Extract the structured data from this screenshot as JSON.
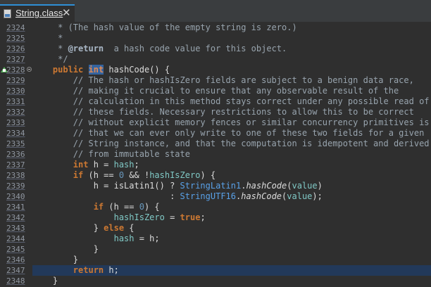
{
  "tab": {
    "title": "String.class",
    "close_glyph": "✕",
    "icon": "class-file-icon"
  },
  "colors": {
    "background": "#2f2f2f",
    "tab_accent": "#2e8fd6",
    "current_line": "#22395a",
    "comment": "#98a4ae",
    "keyword": "#cc7832",
    "class_reference": "#59a1e8",
    "number": "#6897bb"
  },
  "editor": {
    "current_line_number": "2347",
    "override_marker_line": "2328",
    "lines": [
      {
        "number": "2324",
        "tokens": [
          {
            "t": "     * (The hash value of the empty string is zero.)",
            "k": "comment"
          }
        ]
      },
      {
        "number": "2325",
        "tokens": [
          {
            "t": "     *",
            "k": "comment"
          }
        ]
      },
      {
        "number": "2326",
        "tokens": [
          {
            "t": "     * ",
            "k": "comment"
          },
          {
            "t": "@return",
            "k": "tag"
          },
          {
            "t": "  a hash code value for this object.",
            "k": "comment"
          }
        ]
      },
      {
        "number": "2327",
        "tokens": [
          {
            "t": "     */",
            "k": "comment"
          }
        ]
      },
      {
        "number": "2328",
        "tokens": [
          {
            "t": "    ",
            "k": "plain"
          },
          {
            "t": "public",
            "k": "keyword"
          },
          {
            "t": " ",
            "k": "plain"
          },
          {
            "t": "int",
            "k": "type hl"
          },
          {
            "t": " hashCode() {",
            "k": "method"
          }
        ]
      },
      {
        "number": "2329",
        "tokens": [
          {
            "t": "        // The hash or hashIsZero fields are subject to a benign data race,",
            "k": "comment"
          }
        ]
      },
      {
        "number": "2330",
        "tokens": [
          {
            "t": "        // making it crucial to ensure that any observable result of the",
            "k": "comment"
          }
        ]
      },
      {
        "number": "2331",
        "tokens": [
          {
            "t": "        // calculation in this method stays correct under any possible read of",
            "k": "comment"
          }
        ]
      },
      {
        "number": "2332",
        "tokens": [
          {
            "t": "        // these fields. Necessary restrictions to allow this to be correct",
            "k": "comment"
          }
        ]
      },
      {
        "number": "2333",
        "tokens": [
          {
            "t": "        // without explicit memory fences or similar concurrency primitives is",
            "k": "comment"
          }
        ]
      },
      {
        "number": "2334",
        "tokens": [
          {
            "t": "        // that we can ever only write to one of these two fields for a given",
            "k": "comment"
          }
        ]
      },
      {
        "number": "2335",
        "tokens": [
          {
            "t": "        // String instance, and that the computation is idempotent and derived",
            "k": "comment"
          }
        ]
      },
      {
        "number": "2336",
        "tokens": [
          {
            "t": "        // from immutable state",
            "k": "comment"
          }
        ]
      },
      {
        "number": "2337",
        "tokens": [
          {
            "t": "        ",
            "k": "plain"
          },
          {
            "t": "int",
            "k": "type"
          },
          {
            "t": " h = ",
            "k": "plain"
          },
          {
            "t": "hash",
            "k": "field"
          },
          {
            "t": ";",
            "k": "plain"
          }
        ]
      },
      {
        "number": "2338",
        "tokens": [
          {
            "t": "        ",
            "k": "plain"
          },
          {
            "t": "if",
            "k": "keyword"
          },
          {
            "t": " (h == ",
            "k": "plain"
          },
          {
            "t": "0",
            "k": "number"
          },
          {
            "t": " && !",
            "k": "plain"
          },
          {
            "t": "hashIsZero",
            "k": "field"
          },
          {
            "t": ") {",
            "k": "plain"
          }
        ]
      },
      {
        "number": "2339",
        "tokens": [
          {
            "t": "            h = isLatin1() ? ",
            "k": "plain"
          },
          {
            "t": "StringLatin1",
            "k": "class-ref"
          },
          {
            "t": ".",
            "k": "plain"
          },
          {
            "t": "hashCode",
            "k": "static-call"
          },
          {
            "t": "(",
            "k": "plain"
          },
          {
            "t": "value",
            "k": "field"
          },
          {
            "t": ")",
            "k": "plain"
          }
        ]
      },
      {
        "number": "2340",
        "tokens": [
          {
            "t": "                           : ",
            "k": "plain"
          },
          {
            "t": "StringUTF16",
            "k": "class-ref"
          },
          {
            "t": ".",
            "k": "plain"
          },
          {
            "t": "hashCode",
            "k": "static-call"
          },
          {
            "t": "(",
            "k": "plain"
          },
          {
            "t": "value",
            "k": "field"
          },
          {
            "t": ");",
            "k": "plain"
          }
        ]
      },
      {
        "number": "2341",
        "tokens": [
          {
            "t": "            ",
            "k": "plain"
          },
          {
            "t": "if",
            "k": "keyword"
          },
          {
            "t": " (h == ",
            "k": "plain"
          },
          {
            "t": "0",
            "k": "number"
          },
          {
            "t": ") {",
            "k": "plain"
          }
        ]
      },
      {
        "number": "2342",
        "tokens": [
          {
            "t": "                ",
            "k": "plain"
          },
          {
            "t": "hashIsZero",
            "k": "field"
          },
          {
            "t": " = ",
            "k": "plain"
          },
          {
            "t": "true",
            "k": "keyword"
          },
          {
            "t": ";",
            "k": "plain"
          }
        ]
      },
      {
        "number": "2343",
        "tokens": [
          {
            "t": "            } ",
            "k": "plain"
          },
          {
            "t": "else",
            "k": "keyword"
          },
          {
            "t": " {",
            "k": "plain"
          }
        ]
      },
      {
        "number": "2344",
        "tokens": [
          {
            "t": "                ",
            "k": "plain"
          },
          {
            "t": "hash",
            "k": "field"
          },
          {
            "t": " = h;",
            "k": "plain"
          }
        ]
      },
      {
        "number": "2345",
        "tokens": [
          {
            "t": "            }",
            "k": "plain"
          }
        ]
      },
      {
        "number": "2346",
        "tokens": [
          {
            "t": "        }",
            "k": "plain"
          }
        ]
      },
      {
        "number": "2347",
        "tokens": [
          {
            "t": "        ",
            "k": "plain"
          },
          {
            "t": "return",
            "k": "keyword"
          },
          {
            "t": " h;",
            "k": "plain"
          }
        ]
      },
      {
        "number": "2348",
        "tokens": [
          {
            "t": "    }",
            "k": "plain"
          }
        ]
      }
    ]
  }
}
